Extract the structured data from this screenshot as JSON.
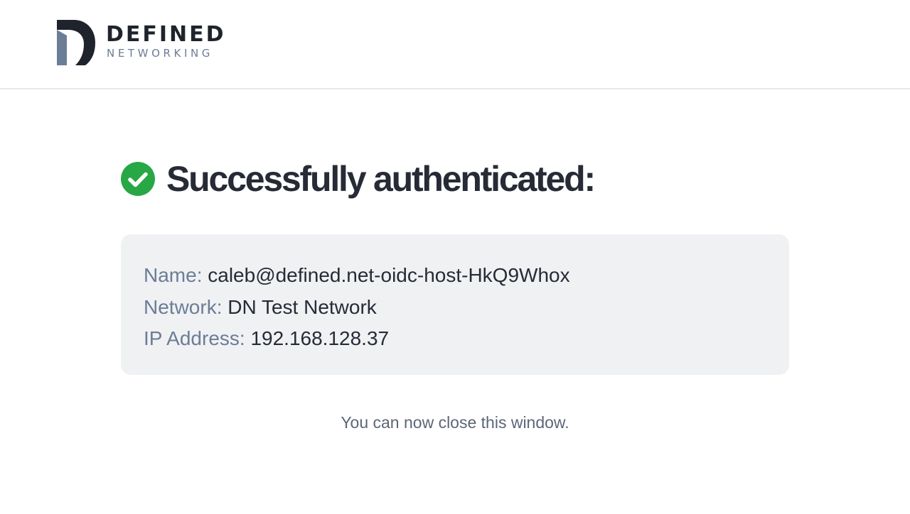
{
  "brand": {
    "name_primary": "DEFINED",
    "name_secondary": "NETWORKING",
    "colors": {
      "dark": "#1f232b",
      "slate": "#6c7d96"
    }
  },
  "status": {
    "icon": "check-circle-icon",
    "color": "#28a745",
    "title": "Successfully authenticated:"
  },
  "details": [
    {
      "label": "Name:",
      "value": "caleb@defined.net-oidc-host-HkQ9Whox"
    },
    {
      "label": "Network:",
      "value": "DN Test Network"
    },
    {
      "label": "IP Address:",
      "value": "192.168.128.37"
    }
  ],
  "footer": {
    "message": "You can now close this window."
  }
}
